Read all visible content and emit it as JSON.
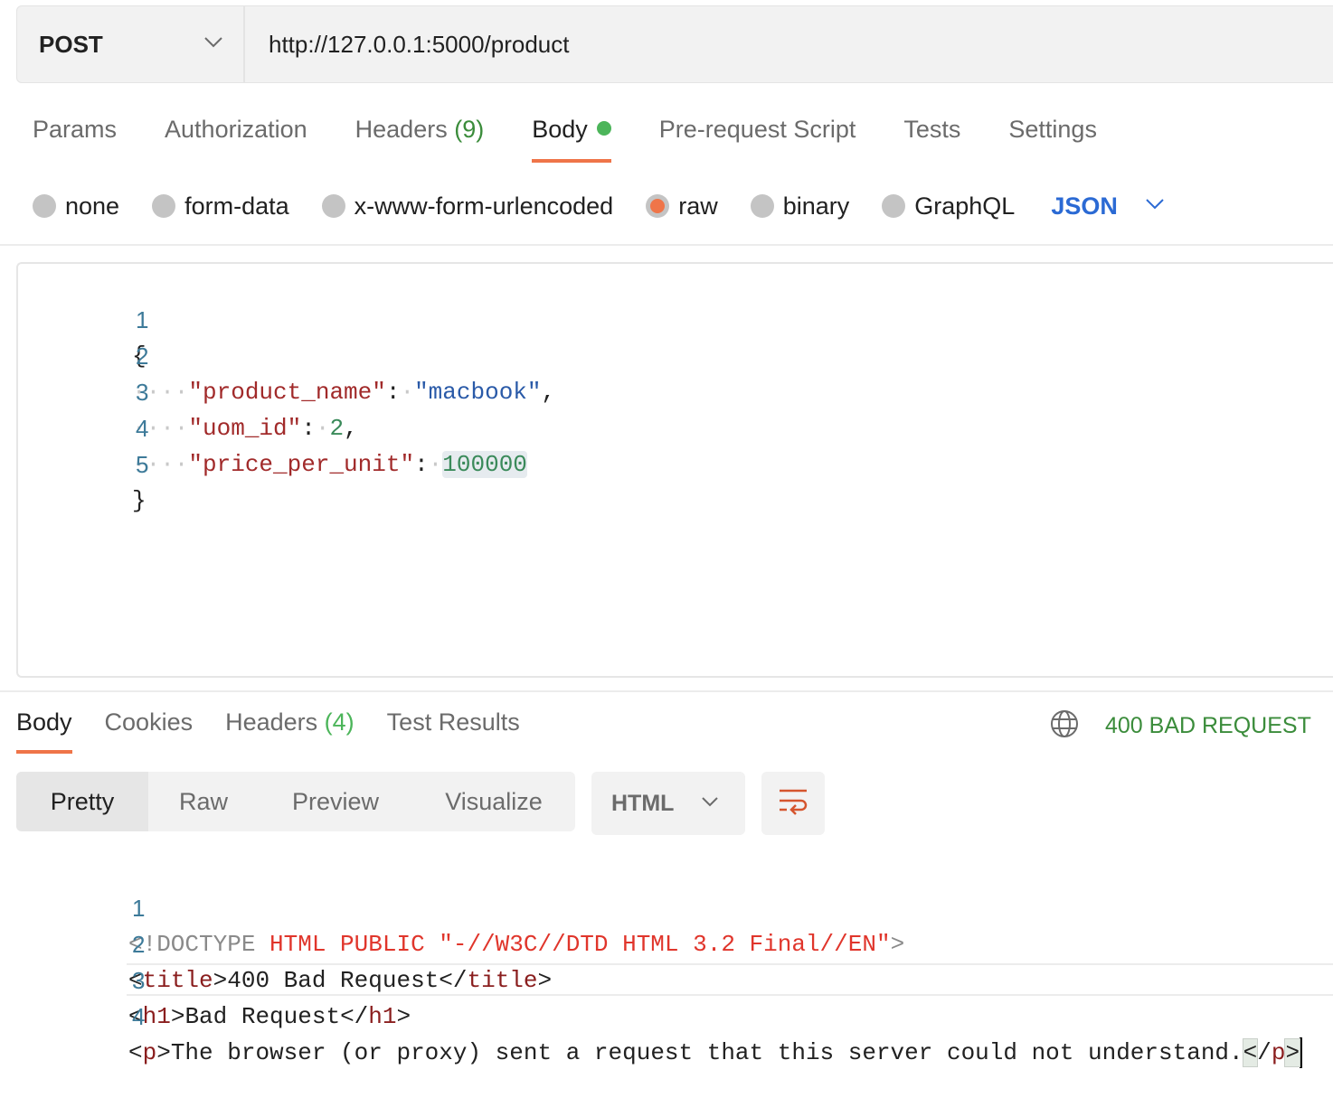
{
  "request": {
    "method": "POST",
    "url": "http://127.0.0.1:5000/product"
  },
  "request_tabs": [
    {
      "label": "Params"
    },
    {
      "label": "Authorization"
    },
    {
      "label": "Headers",
      "count": "(9)"
    },
    {
      "label": "Body",
      "active": true,
      "indicator": "green-dot"
    },
    {
      "label": "Pre-request Script"
    },
    {
      "label": "Tests"
    },
    {
      "label": "Settings"
    }
  ],
  "body_types": [
    {
      "label": "none",
      "checked": false
    },
    {
      "label": "form-data",
      "checked": false
    },
    {
      "label": "x-www-form-urlencoded",
      "checked": false
    },
    {
      "label": "raw",
      "checked": true
    },
    {
      "label": "binary",
      "checked": false
    },
    {
      "label": "GraphQL",
      "checked": false
    }
  ],
  "raw_language": "JSON",
  "request_body": {
    "line_numbers": [
      "1",
      "2",
      "3",
      "4",
      "5"
    ],
    "open_brace": "{",
    "close_brace": "}",
    "fields": [
      {
        "key": "\"product_name\"",
        "value": "\"macbook\"",
        "value_type": "string",
        "trailing": ","
      },
      {
        "key": "\"uom_id\"",
        "value": "2",
        "value_type": "number",
        "trailing": ","
      },
      {
        "key": "\"price_per_unit\"",
        "value": "100000",
        "value_type": "number",
        "trailing": ""
      }
    ]
  },
  "response_tabs": [
    {
      "label": "Body",
      "active": true
    },
    {
      "label": "Cookies"
    },
    {
      "label": "Headers",
      "count": "(4)"
    },
    {
      "label": "Test Results"
    }
  ],
  "response_status": {
    "icon": "globe-icon",
    "text": "400 BAD REQUEST",
    "color": "#3b8c3b"
  },
  "view_modes": [
    {
      "label": "Pretty",
      "active": true
    },
    {
      "label": "Raw"
    },
    {
      "label": "Preview"
    },
    {
      "label": "Visualize"
    }
  ],
  "response_format": "HTML",
  "wrap_icon": "wrap-lines-icon",
  "response_body": {
    "line_numbers": [
      "1",
      "2",
      "3",
      "4"
    ],
    "line1": {
      "doctype": "<!DOCTYPE",
      "public": " HTML PUBLIC \"-//W3C//DTD HTML 3.2 Final//EN\"",
      "close": ">"
    },
    "line2": {
      "open_lt": "<",
      "tag": "title",
      "open_gt": ">",
      "text": "400 Bad Request",
      "close_lt": "</",
      "close_gt": ">"
    },
    "line3": {
      "open_lt": "<",
      "tag": "h1",
      "open_gt": ">",
      "text": "Bad Request",
      "close_lt": "</",
      "close_gt": ">"
    },
    "line4": {
      "open_lt": "<",
      "tag": "p",
      "open_gt": ">",
      "text": "The browser (or proxy) sent a request that this server could not understand.",
      "close_lt": "<",
      "close_slash": "/",
      "close_gt": ">"
    }
  },
  "colors": {
    "accent": "#ef7549",
    "link_blue": "#2b6ad4",
    "success_green": "#4cb55a"
  }
}
